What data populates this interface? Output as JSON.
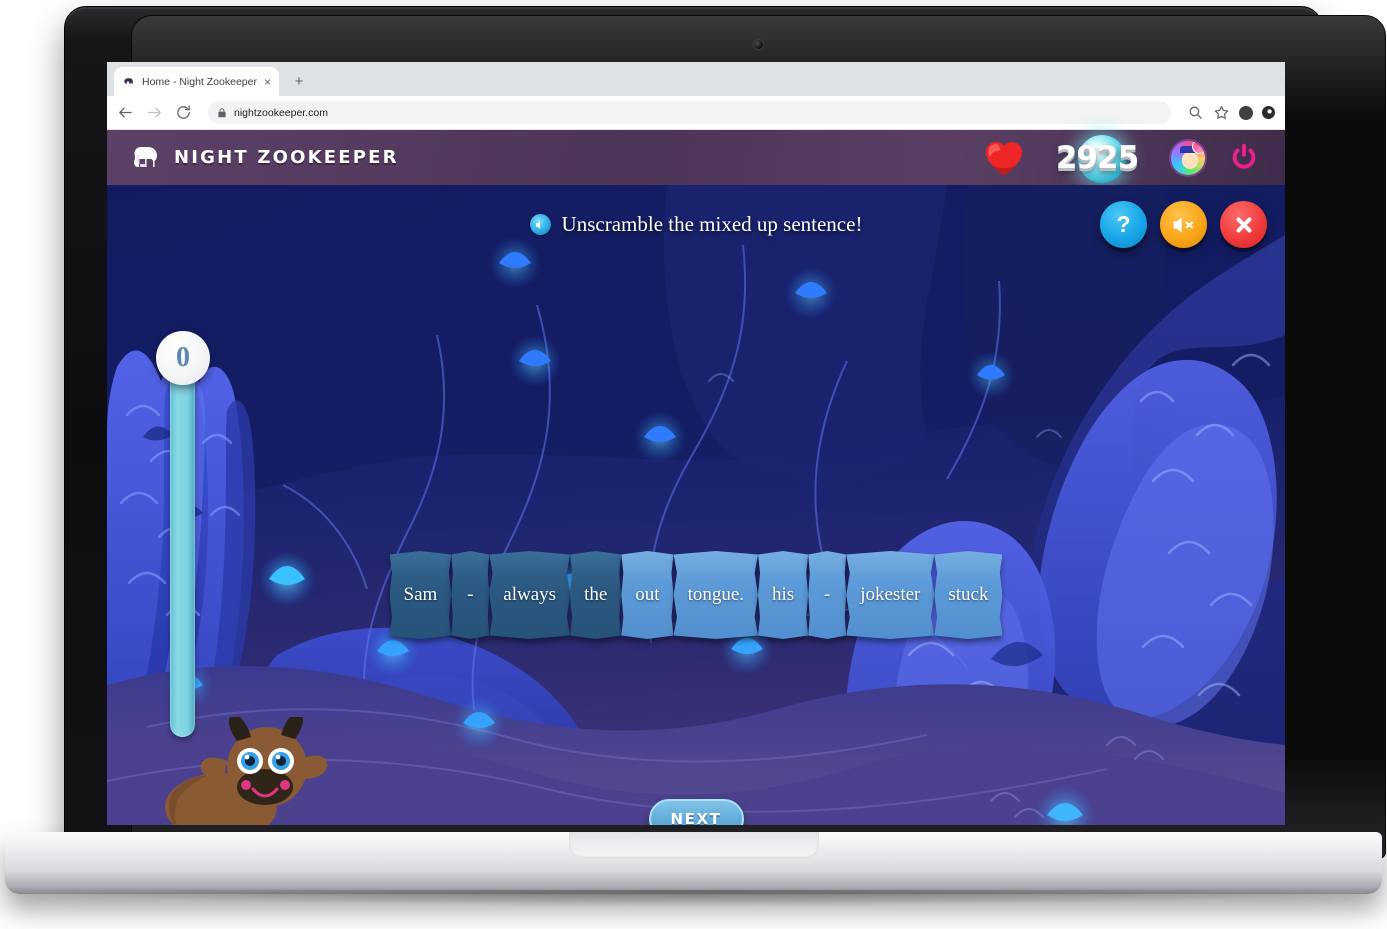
{
  "browser": {
    "tab": {
      "title": "Home - Night Zookeeper",
      "favicon_icon": "elephant-favicon",
      "close_icon": "×"
    },
    "new_tab_icon": "+",
    "nav": {
      "back_icon": "←",
      "forward_icon": "→",
      "reload_icon": "⟳"
    },
    "address": {
      "lock_icon": "lock-icon",
      "url": "nightzookeeper.com"
    },
    "toolbar_right": {
      "search_icon": "search-icon",
      "bookmark_icon": "star-icon",
      "profile_icon": "profile-avatar",
      "menu_icon": "extensions-icon"
    }
  },
  "app_header": {
    "logo_icon": "elephant-logo",
    "wordmark": "NIGHT ZOOKEEPER",
    "heart_icon": "heart-icon",
    "score": "2925",
    "orb_icon": "score-orb",
    "avatar_icon": "user-avatar",
    "power_icon": "power-icon",
    "brand_purple": "#4d3557",
    "power_pink": "#ec1f8c"
  },
  "game": {
    "instruction": "Unscramble the mixed up sentence!",
    "speaker_icon": "speaker-play-icon",
    "buttons": [
      {
        "name": "help-button",
        "glyph": "?",
        "color": "#17a5e8"
      },
      {
        "name": "mute-button",
        "glyph": "speaker-muted-icon",
        "color": "#f9a61a"
      },
      {
        "name": "close-button",
        "glyph": "✕",
        "color": "#ef3d3d"
      }
    ],
    "progress": {
      "value": "0",
      "track_color": "#7ed2e2"
    },
    "tiles": [
      {
        "text": "Sam",
        "tone": "dark"
      },
      {
        "text": "-",
        "tone": "dark"
      },
      {
        "text": "always",
        "tone": "dark"
      },
      {
        "text": "the",
        "tone": "dark"
      },
      {
        "text": "out",
        "tone": "light"
      },
      {
        "text": "tongue.",
        "tone": "light"
      },
      {
        "text": "his",
        "tone": "light"
      },
      {
        "text": "-",
        "tone": "light"
      },
      {
        "text": "jokester",
        "tone": "light"
      },
      {
        "text": "stuck",
        "tone": "light"
      }
    ],
    "next_label": "NEXT",
    "character_icon": "cow-character"
  }
}
